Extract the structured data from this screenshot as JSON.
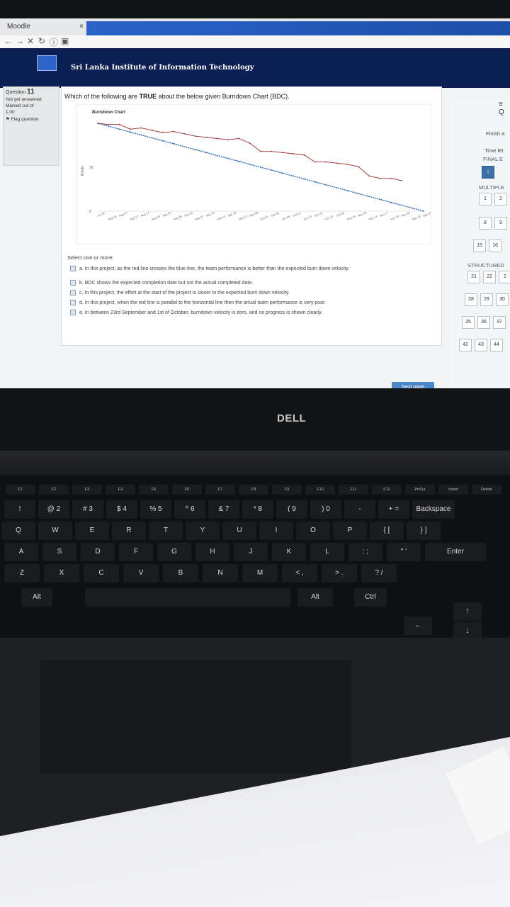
{
  "browser": {
    "tab_title": "Moodle",
    "tab_close": "×",
    "nav_icons": [
      "back-icon",
      "forward-icon",
      "stop-icon",
      "reload-icon",
      "info-icon",
      "bookmark-icon"
    ]
  },
  "site": {
    "title": "Sri Lanka Institute of Information Technology"
  },
  "quiz_info": {
    "question_prefix": "Question",
    "question_number": "11",
    "status": "Not yet answered",
    "marked_out_of": "Marked out of",
    "marks": "1.00",
    "flag": "Flag question"
  },
  "question": {
    "text_before": "Which of the following are ",
    "text_bold": "TRUE",
    "text_after": " about the below given Burndown Chart (BDC).",
    "select_prompt": "Select one or more:",
    "options": [
      "a. In this project, as the red line crosses the blue line, the team performance is better than the expected burn down velocity.",
      "b. BDC shows the expected completion date but not the actual completed date.",
      "c. In this project, the effort at the start of the project is closer to the expected burn down velocity.",
      "d. In this project, when the red line is parallel to the horizontal line then the artual team performance is very poor.",
      "e. In between 23rd September and 1st of October, burndown velocity is zero, and no progress is shown clearly."
    ],
    "next_button": "Next page"
  },
  "chart_data": {
    "type": "line",
    "title": "Burndown Chart",
    "ylabel": "Points",
    "ytick_labels": [
      "75",
      "0"
    ],
    "x": [
      "Jul 30",
      "Aug 04",
      "Aug 07",
      "Aug 12",
      "Aug 17",
      "Aug 20",
      "Aug 25",
      "Aug 28",
      "Sep 02",
      "Sep 07",
      "Sep 10",
      "Sep 15",
      "Sep 18",
      "Sep 23",
      "Sep 28",
      "Oct 01",
      "Oct 06",
      "Oct 09",
      "Oct 14",
      "Oct 19",
      "Oct 22",
      "Oct 27",
      "Oct 30",
      "Nov 04",
      "Nov 09",
      "Nov 12",
      "Nov 17",
      "Nov 20",
      "Nov 25",
      "Nov 30",
      "Dec 03"
    ],
    "series": [
      {
        "color": "#2e6fb8",
        "values": [
          150,
          145,
          140,
          135,
          130,
          125,
          120,
          115,
          110,
          105,
          100,
          95,
          90,
          85,
          80,
          75,
          70,
          65,
          60,
          55,
          50,
          45,
          40,
          35,
          30,
          25,
          20,
          15,
          10,
          5,
          0
        ]
      },
      {
        "color": "#9b2d2d",
        "values": [
          150,
          148,
          148,
          140,
          142,
          138,
          134,
          136,
          132,
          128,
          126,
          124,
          122,
          124,
          116,
          102,
          102,
          100,
          98,
          96,
          84,
          84,
          82,
          80,
          76,
          60,
          56,
          56,
          52,
          null,
          null
        ]
      }
    ]
  },
  "nav_panel": {
    "menu_icon": "≡ Q",
    "finish": "Finish a",
    "time_left": "Time let",
    "final": "FINAL E",
    "info_mark": "i",
    "section_multiple": "MULTIPLE",
    "section_structured": "STRUCTURED",
    "row1": [
      "1",
      "2"
    ],
    "row2": [
      "8",
      "9"
    ],
    "row3": [
      "15",
      "16"
    ],
    "row4": [
      "21",
      "22",
      "2"
    ],
    "row5": [
      "28",
      "29",
      "30"
    ],
    "row6": [
      "35",
      "36",
      "37"
    ],
    "row7": [
      "42",
      "43",
      "44"
    ]
  },
  "laptop": {
    "brand": "DELL",
    "fkeys": [
      "F1",
      "F2",
      "F3",
      "F4",
      "F5",
      "F6",
      "F7",
      "F8",
      "F9",
      "F10",
      "F11",
      "F12",
      "PrtScr",
      "Insert",
      "Delete"
    ],
    "row_numbers": [
      "!",
      "@ 2",
      "# 3",
      "$ 4",
      "% 5",
      "^ 6",
      "& 7",
      "* 8",
      "( 9",
      ") 0",
      "-",
      "+ =",
      "Backspace"
    ],
    "row_q": [
      "Q",
      "W",
      "E",
      "R",
      "T",
      "Y",
      "U",
      "I",
      "O",
      "P",
      "{ [",
      "} ]"
    ],
    "row_a": [
      "A",
      "S",
      "D",
      "F",
      "G",
      "H",
      "J",
      "K",
      "L",
      ": ;",
      "\" '",
      "Enter"
    ],
    "row_z": [
      "Z",
      "X",
      "C",
      "V",
      "B",
      "N",
      "M",
      "< ,",
      "> .",
      "? /"
    ],
    "row_bottom": [
      "Alt",
      "Alt",
      "Ctrl"
    ]
  }
}
